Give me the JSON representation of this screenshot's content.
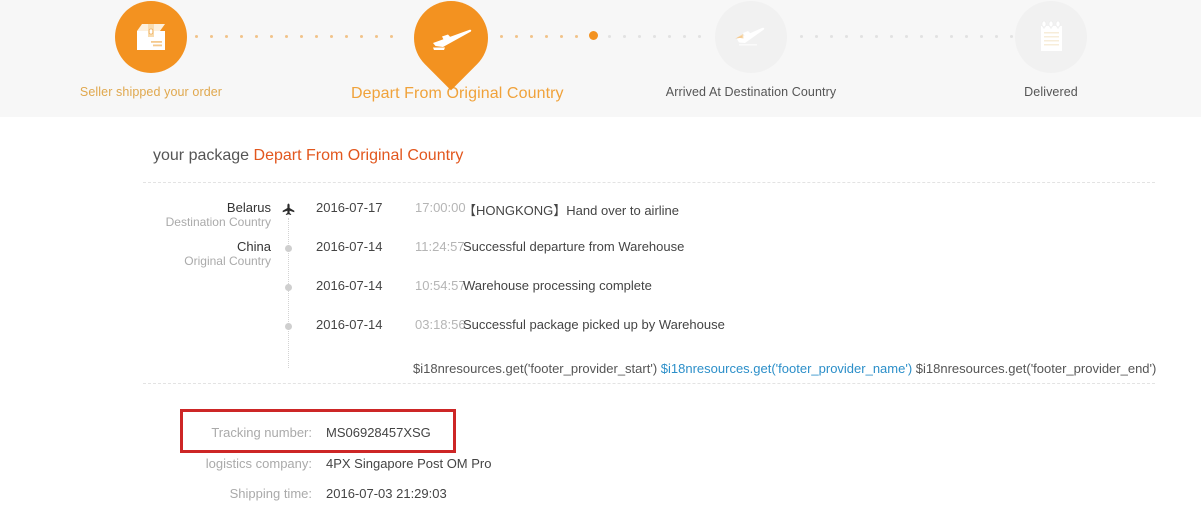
{
  "progress": {
    "steps": [
      {
        "label": "Seller shipped your order",
        "icon": "package-box-icon",
        "state": "done",
        "marker": "circle"
      },
      {
        "label": "Depart From Original Country",
        "icon": "airplane-takeoff-icon",
        "state": "current",
        "marker": "pin"
      },
      {
        "label": "Arrived At Destination Country",
        "icon": "airplane-landing-icon",
        "state": "pending",
        "marker": "circle"
      },
      {
        "label": "Delivered",
        "icon": "notepad-icon",
        "state": "pending",
        "marker": "circle"
      }
    ],
    "accent_color": "#f39220",
    "pending_color": "#f1f1f1"
  },
  "heading": {
    "prefix": "your package",
    "status": "Depart From Original Country",
    "status_color": "#e2571e"
  },
  "timeline": {
    "rows": [
      {
        "country": "Belarus",
        "country_sub": "Destination Country",
        "marker": "airplane-icon",
        "date": "2016-07-17",
        "time": "17:00:00",
        "description": "【HONGKONG】Hand over to airline"
      },
      {
        "country": "China",
        "country_sub": "Original Country",
        "marker": "dot-icon",
        "date": "2016-07-14",
        "time": "11:24:57",
        "description": "Successful departure from Warehouse"
      },
      {
        "country": "",
        "country_sub": "",
        "marker": "dot-icon",
        "date": "2016-07-14",
        "time": "10:54:57",
        "description": "Warehouse processing complete"
      },
      {
        "country": "",
        "country_sub": "",
        "marker": "dot-icon",
        "date": "2016-07-14",
        "time": "03:18:56",
        "description": "Successful package picked up by Warehouse"
      }
    ]
  },
  "i18n_footer": {
    "part1": "$i18nresources.get('footer_provider_start')",
    "part2": "$i18nresources.get('footer_provider_name')",
    "part3": "$i18nresources.get('footer_provider_end')",
    "link_color": "#2c8fc9"
  },
  "details": {
    "highlight_color": "#cd2626",
    "rows": [
      {
        "label": "Tracking number:",
        "value": "MS06928457XSG",
        "highlighted": true
      },
      {
        "label": "logistics company:",
        "value": "4PX Singapore Post OM Pro",
        "highlighted": false
      },
      {
        "label": "Shipping time:",
        "value": "2016-07-03 21:29:03",
        "highlighted": false
      }
    ]
  }
}
